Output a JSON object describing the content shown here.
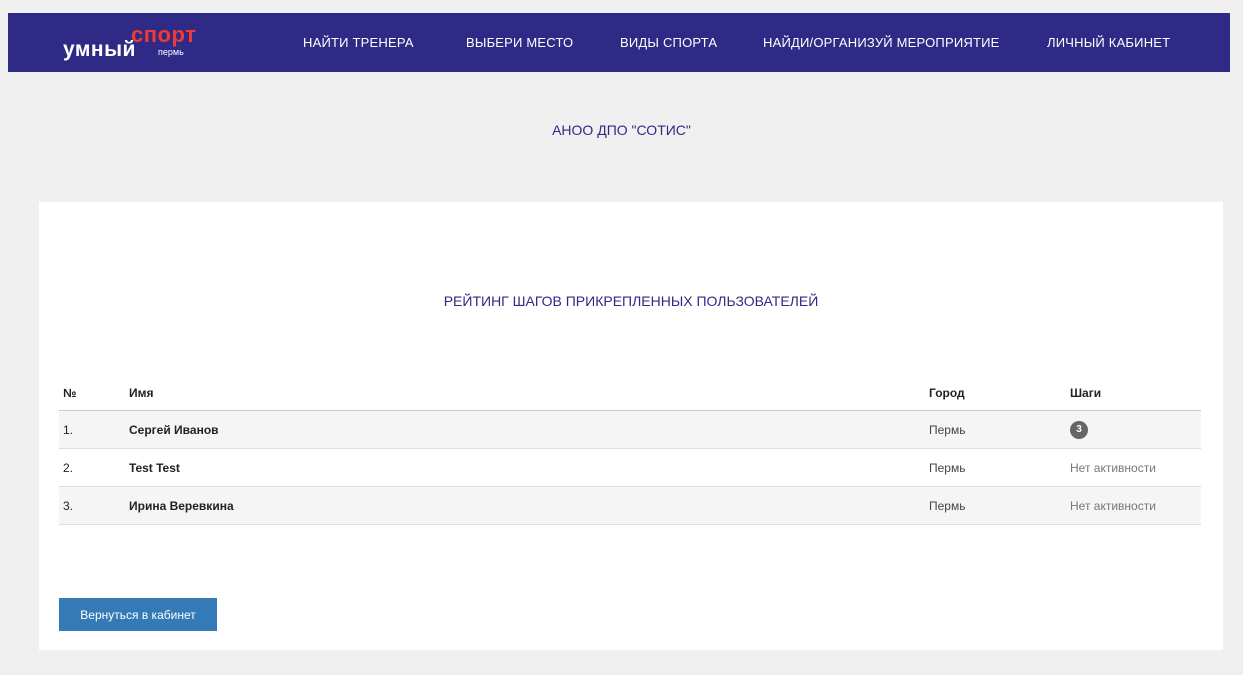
{
  "logo": {
    "word1": "умный",
    "word2": "спорт",
    "city": "пермь"
  },
  "nav": [
    {
      "label": "НАЙТИ ТРЕНЕРА"
    },
    {
      "label": "ВЫБЕРИ МЕСТО"
    },
    {
      "label": "ВИДЫ СПОРТА"
    },
    {
      "label": "НАЙДИ/ОРГАНИЗУЙ МЕРОПРИЯТИЕ"
    },
    {
      "label": "ЛИЧНЫЙ КАБИНЕТ"
    }
  ],
  "organization": "АНОО ДПО \"СОТИС\"",
  "rating": {
    "title": "РЕЙТИНГ ШАГОВ ПРИКРЕПЛЕННЫХ ПОЛЬЗОВАТЕЛЕЙ",
    "columns": {
      "num": "№",
      "name": "Имя",
      "city": "Город",
      "steps": "Шаги"
    },
    "rows": [
      {
        "num": "1.",
        "name": "Сергей Иванов",
        "city": "Пермь",
        "steps": "3"
      },
      {
        "num": "2.",
        "name": "Test Test",
        "city": "Пермь",
        "steps": "Нет активности"
      },
      {
        "num": "3.",
        "name": "Ирина Веревкина",
        "city": "Пермь",
        "steps": "Нет активности"
      }
    ]
  },
  "back_button": "Вернуться в кабинет",
  "colors": {
    "brand": "#2f2a86",
    "accent": "#ee3b34",
    "button": "#337ab7"
  }
}
